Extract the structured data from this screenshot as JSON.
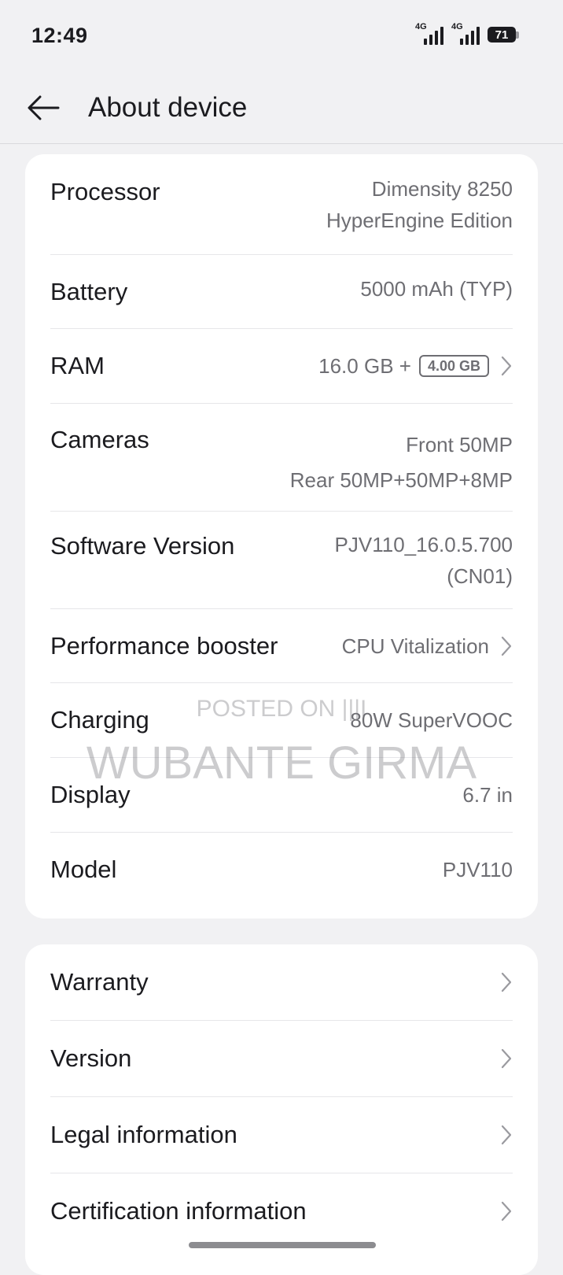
{
  "status_bar": {
    "time": "12:49",
    "network1": "4G",
    "network2": "4G",
    "battery_level": "71"
  },
  "header": {
    "title": "About device"
  },
  "specs": [
    {
      "label": "Processor",
      "value_line1": "Dimensity 8250",
      "value_line2": "HyperEngine Edition"
    },
    {
      "label": "Battery",
      "value": "5000 mAh (TYP)"
    },
    {
      "label": "RAM",
      "value": "16.0 GB +",
      "badge": "4.00 GB"
    },
    {
      "label": "Cameras",
      "value_line1": "Front 50MP",
      "value_line2": "Rear 50MP+50MP+8MP"
    },
    {
      "label": "Software Version",
      "value_line1": "PJV110_16.0.5.700",
      "value_line2": "(CN01)"
    },
    {
      "label": "Performance booster",
      "value": "CPU Vitalization"
    },
    {
      "label": "Charging",
      "value": "80W SuperVOOC"
    },
    {
      "label": "Display",
      "value": "6.7 in"
    },
    {
      "label": "Model",
      "value": "PJV110"
    }
  ],
  "links": [
    {
      "label": "Warranty"
    },
    {
      "label": "Version"
    },
    {
      "label": "Legal information"
    },
    {
      "label": "Certification information"
    }
  ],
  "watermark": {
    "line1": "POSTED ON |||I",
    "line2": "WUBANTE GIRMA"
  },
  "colors": {
    "background": "#f1f1f3",
    "card": "#ffffff",
    "primary_text": "#1b1b1f",
    "secondary_text": "#6e6e73"
  }
}
